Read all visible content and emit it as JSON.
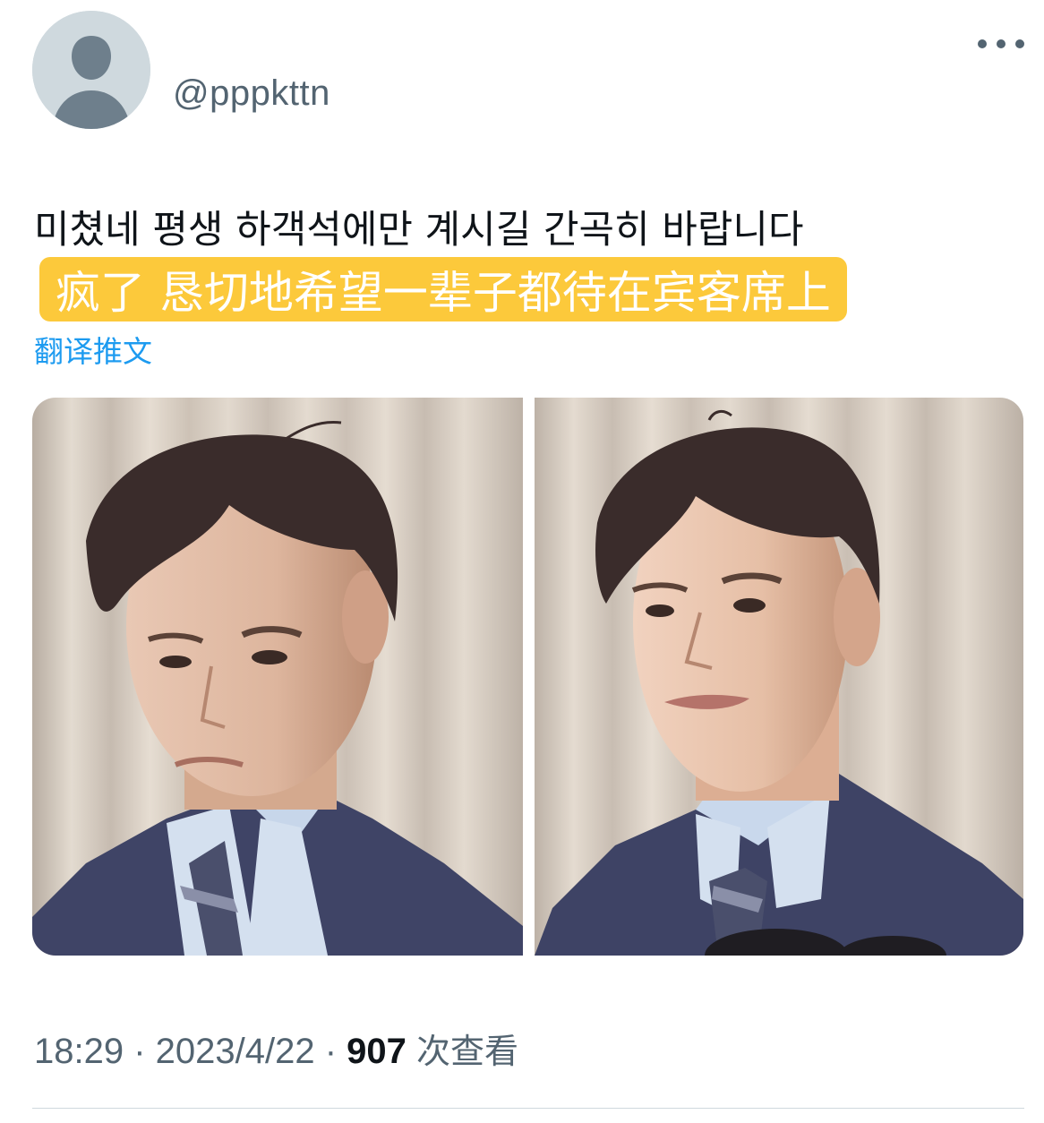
{
  "author": {
    "handle": "@pppkttn",
    "avatar_icon": "default-profile-icon"
  },
  "more_icon": "more-horizontal-icon",
  "tweet": {
    "text": "미쳤네 평생 하객석에만 계시길 간곡히 바랍니다",
    "translation": "疯了 恳切地希望一辈子都待在宾客席上",
    "translate_link": "翻译推文"
  },
  "media": {
    "photos": [
      {
        "description": "photo-1"
      },
      {
        "description": "photo-2"
      }
    ]
  },
  "meta": {
    "time": "18:29",
    "separator": " · ",
    "date": "2023/4/22",
    "views_count": "907",
    "views_label": "次查看"
  },
  "colors": {
    "text_primary": "#0f1419",
    "text_secondary": "#536471",
    "link": "#1d9bf0",
    "highlight": "#fcc93b",
    "divider": "#cfd9de"
  }
}
